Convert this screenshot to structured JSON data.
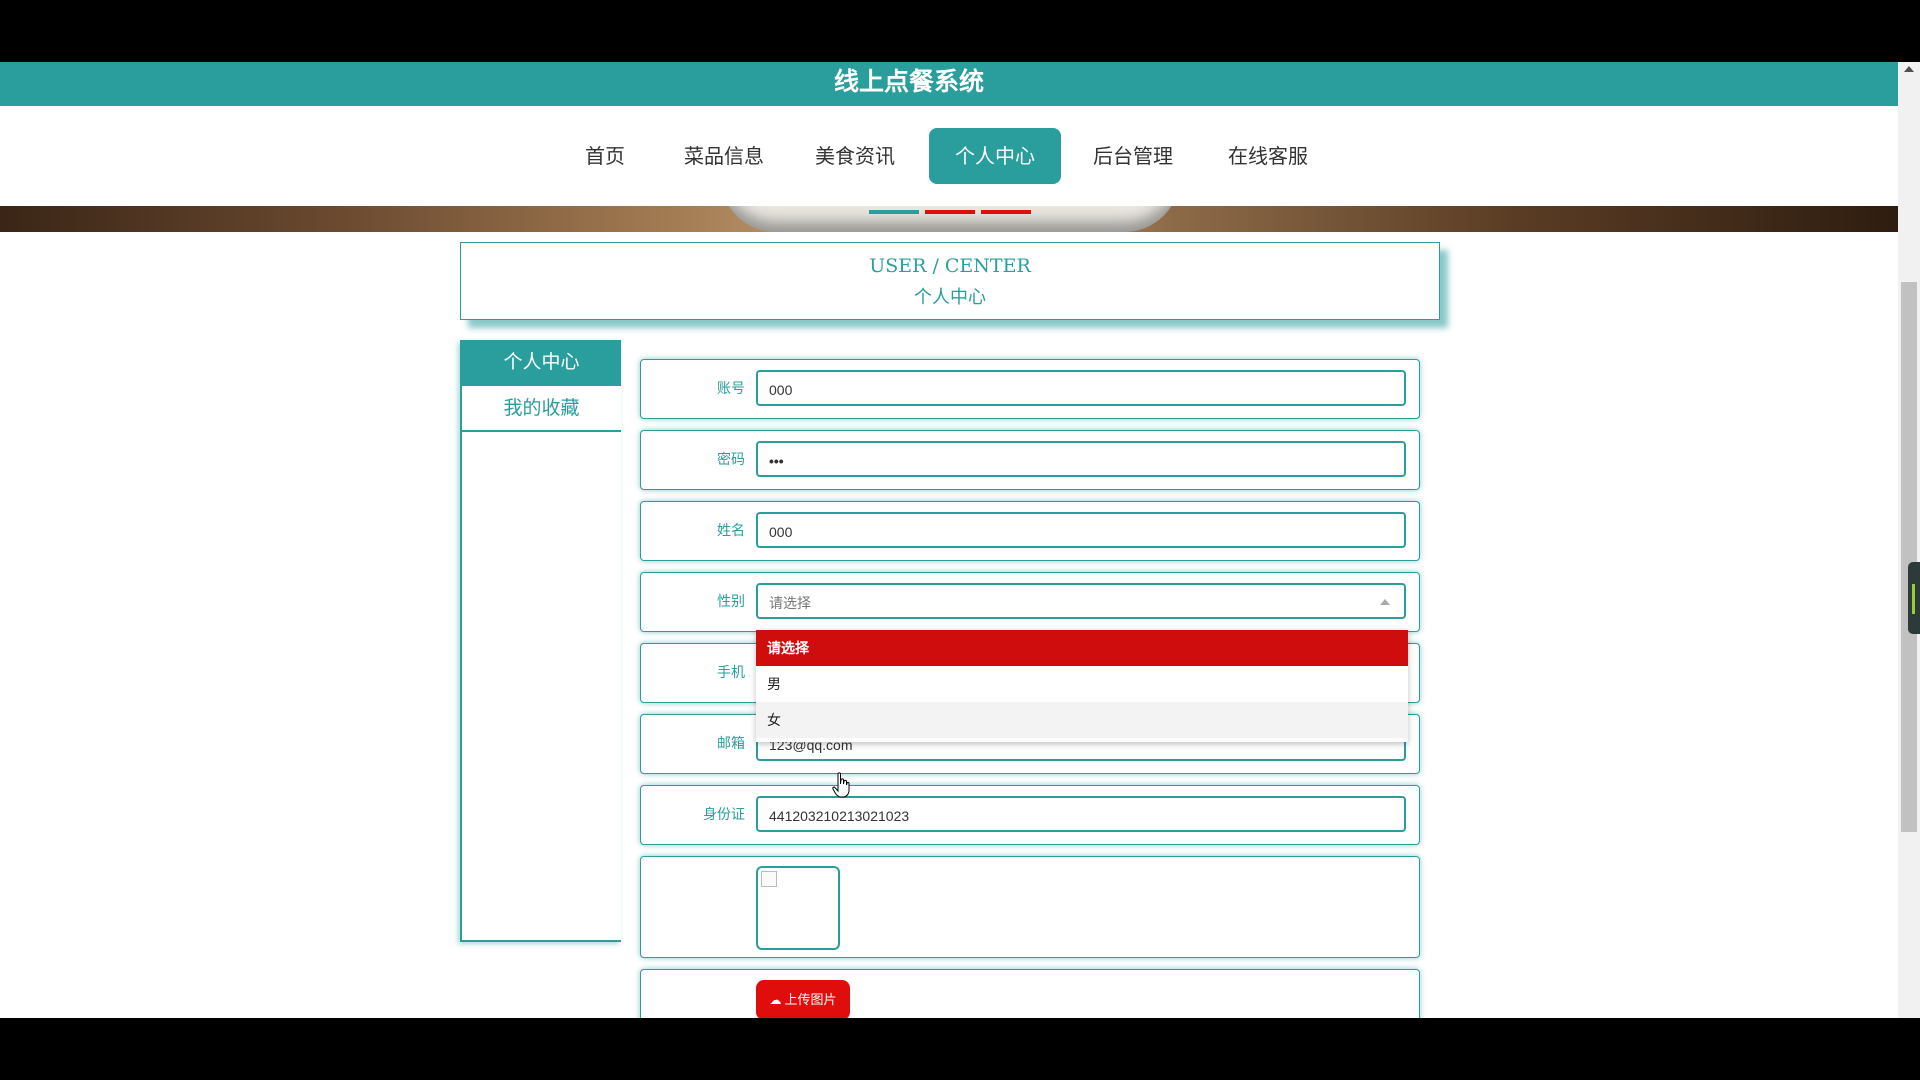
{
  "site": {
    "title": "线上点餐系统"
  },
  "nav": {
    "items": [
      {
        "label": "首页"
      },
      {
        "label": "菜品信息"
      },
      {
        "label": "美食资讯"
      },
      {
        "label": "个人中心"
      },
      {
        "label": "后台管理"
      },
      {
        "label": "在线客服"
      }
    ],
    "active_index": 3
  },
  "page_header": {
    "title_en": "USER / CENTER",
    "title_cn": "个人中心"
  },
  "sidebar": {
    "items": [
      {
        "label": "个人中心"
      },
      {
        "label": "我的收藏"
      }
    ],
    "active_index": 0
  },
  "form": {
    "account": {
      "label": "账号",
      "value": "000"
    },
    "password": {
      "label": "密码",
      "value": "•••"
    },
    "name": {
      "label": "姓名",
      "value": "000"
    },
    "gender": {
      "label": "性别",
      "placeholder": "请选择"
    },
    "phone": {
      "label": "手机"
    },
    "email": {
      "label": "邮箱",
      "value": "123@qq.com"
    },
    "id_card": {
      "label": "身份证",
      "value": "441203210213021023"
    },
    "upload_label": "上传图片"
  },
  "gender_dropdown": {
    "options": [
      "请选择",
      "男",
      "女"
    ],
    "selected_index": 0,
    "hover_index": 2
  },
  "colors": {
    "accent": "#2a9d9d",
    "danger": "#e00d0d",
    "selected_option": "#d00d0d"
  }
}
